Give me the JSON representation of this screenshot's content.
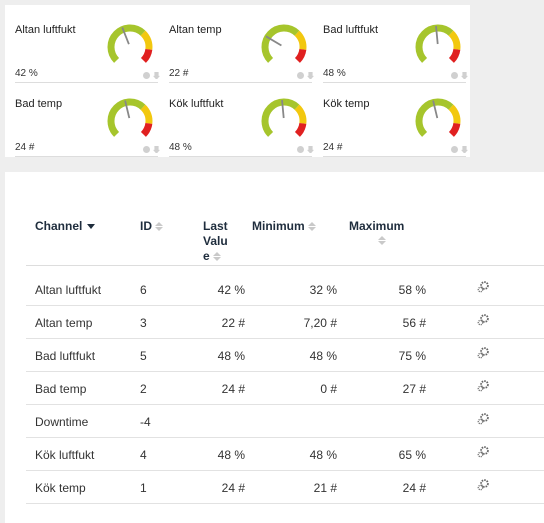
{
  "gauges": [
    {
      "name": "Altan luftfukt",
      "value": "42 %",
      "level": 0.42
    },
    {
      "name": "Altan temp",
      "value": "22 #",
      "level": 0.28
    },
    {
      "name": "Bad luftfukt",
      "value": "48 %",
      "level": 0.48
    },
    {
      "name": "Bad temp",
      "value": "24 #",
      "level": 0.45
    },
    {
      "name": "Kök luftfukt",
      "value": "48 %",
      "level": 0.48
    },
    {
      "name": "Kök temp",
      "value": "24 #",
      "level": 0.45
    }
  ],
  "table": {
    "headers": {
      "channel": "Channel",
      "id": "ID",
      "last_value": [
        "Last",
        "Valu",
        "e"
      ],
      "minimum": "Minimum",
      "maximum": "Maximum"
    },
    "rows": [
      {
        "channel": "Altan luftfukt",
        "id": "6",
        "last": "42 %",
        "min": "32 %",
        "max": "58 %"
      },
      {
        "channel": "Altan temp",
        "id": "3",
        "last": "22 #",
        "min": "7,20 #",
        "max": "56 #"
      },
      {
        "channel": "Bad luftfukt",
        "id": "5",
        "last": "48 %",
        "min": "48 %",
        "max": "75 %"
      },
      {
        "channel": "Bad temp",
        "id": "2",
        "last": "24 #",
        "min": "0 #",
        "max": "27 #"
      },
      {
        "channel": "Downtime",
        "id": "-4",
        "last": "",
        "min": "",
        "max": ""
      },
      {
        "channel": "Kök luftfukt",
        "id": "4",
        "last": "48 %",
        "min": "48 %",
        "max": "65 %"
      },
      {
        "channel": "Kök temp",
        "id": "1",
        "last": "24 #",
        "min": "21 #",
        "max": "24 #"
      }
    ]
  },
  "colors": {
    "gauge_green": "#a6c52c",
    "gauge_yellow": "#f2c80f",
    "gauge_red": "#e02020",
    "needle": "#888888"
  }
}
